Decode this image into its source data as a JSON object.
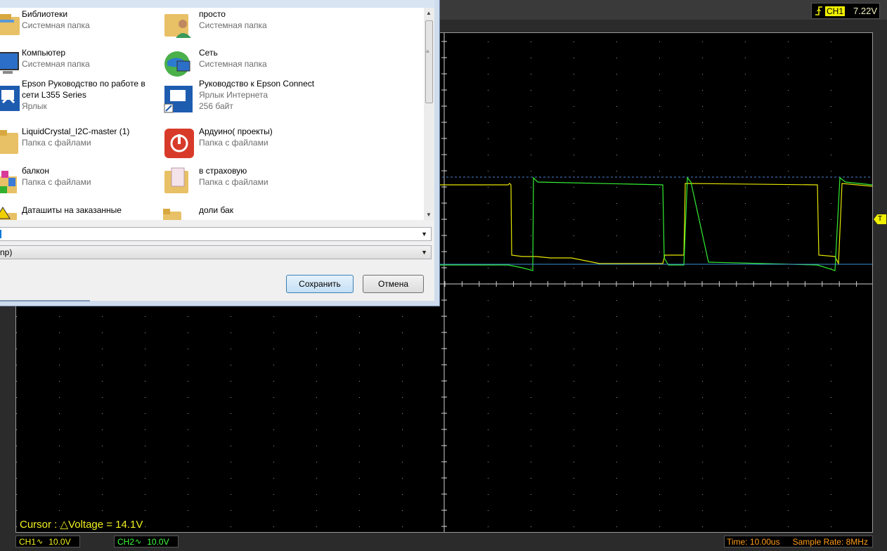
{
  "scope": {
    "trigger": {
      "channel": "CH1",
      "level": "7.22V",
      "marker": "T"
    },
    "cursor_readout": "Cursor : △Voltage = 14.1V",
    "ch1": {
      "name": "CH1",
      "scale": "10.0V",
      "color": "#f0f020"
    },
    "ch2": {
      "name": "CH2",
      "scale": "10.0V",
      "color": "#40ff40"
    },
    "time": "Time: 10.00us",
    "sample_rate": "Sample Rate: 8MHz",
    "wave_glyph": "∿"
  },
  "dialog": {
    "files": [
      {
        "name": "Библиотеки",
        "sub": "Системная папка",
        "sub2": "",
        "icon": "libraries-folder-icon"
      },
      {
        "name": "просто",
        "sub": "Системная папка",
        "sub2": "",
        "icon": "user-folder-icon"
      },
      {
        "name": "Компьютер",
        "sub": "Системная папка",
        "sub2": "",
        "icon": "computer-icon"
      },
      {
        "name": "Сеть",
        "sub": "Системная папка",
        "sub2": "",
        "icon": "network-globe-icon"
      },
      {
        "name": "Epson Руководство по работе в",
        "name2": "сети L355 Series",
        "sub": "Ярлык",
        "sub2": "",
        "icon": "epson-manual-shortcut-icon"
      },
      {
        "name": "Руководство к Epson Connect",
        "sub": "Ярлык Интернета",
        "sub2": "256 байт",
        "icon": "epson-connect-shortcut-icon"
      },
      {
        "name": "LiquidCrystal_I2C-master (1)",
        "sub": "Папка с файлами",
        "sub2": "",
        "icon": "folder-icon"
      },
      {
        "name": "Ардуино( проекты)",
        "sub": "Папка с файлами",
        "sub2": "",
        "icon": "power-app-icon"
      },
      {
        "name": "балкон",
        "sub": "Папка с файлами",
        "sub2": "",
        "icon": "media-folder-icon"
      },
      {
        "name": "в страховую",
        "sub": "Папка с файлами",
        "sub2": "",
        "icon": "document-folder-icon"
      },
      {
        "name": "Даташиты на заказанные",
        "sub": "",
        "sub2": "",
        "icon": "warning-folder-icon"
      },
      {
        "name": "доли бак",
        "sub": "",
        "sub2": "",
        "icon": "folder-icon"
      }
    ],
    "filetype_value": "np)",
    "save_label": "Сохранить",
    "cancel_label": "Отмена"
  }
}
